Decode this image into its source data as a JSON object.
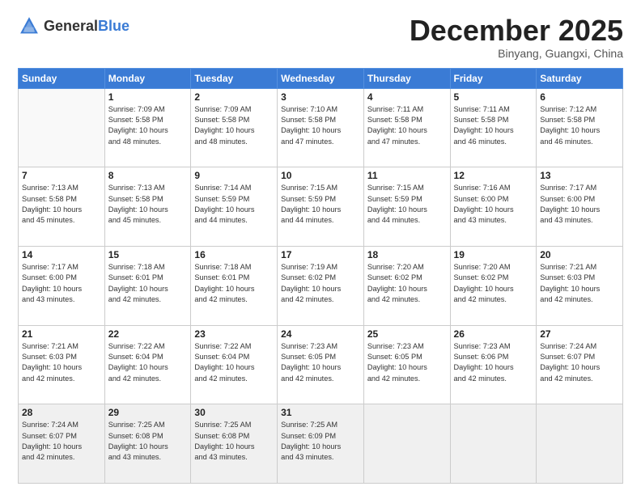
{
  "header": {
    "logo_general": "General",
    "logo_blue": "Blue",
    "month": "December 2025",
    "location": "Binyang, Guangxi, China"
  },
  "weekdays": [
    "Sunday",
    "Monday",
    "Tuesday",
    "Wednesday",
    "Thursday",
    "Friday",
    "Saturday"
  ],
  "weeks": [
    [
      {
        "day": "",
        "info": ""
      },
      {
        "day": "1",
        "info": "Sunrise: 7:09 AM\nSunset: 5:58 PM\nDaylight: 10 hours\nand 48 minutes."
      },
      {
        "day": "2",
        "info": "Sunrise: 7:09 AM\nSunset: 5:58 PM\nDaylight: 10 hours\nand 48 minutes."
      },
      {
        "day": "3",
        "info": "Sunrise: 7:10 AM\nSunset: 5:58 PM\nDaylight: 10 hours\nand 47 minutes."
      },
      {
        "day": "4",
        "info": "Sunrise: 7:11 AM\nSunset: 5:58 PM\nDaylight: 10 hours\nand 47 minutes."
      },
      {
        "day": "5",
        "info": "Sunrise: 7:11 AM\nSunset: 5:58 PM\nDaylight: 10 hours\nand 46 minutes."
      },
      {
        "day": "6",
        "info": "Sunrise: 7:12 AM\nSunset: 5:58 PM\nDaylight: 10 hours\nand 46 minutes."
      }
    ],
    [
      {
        "day": "7",
        "info": "Sunrise: 7:13 AM\nSunset: 5:58 PM\nDaylight: 10 hours\nand 45 minutes."
      },
      {
        "day": "8",
        "info": "Sunrise: 7:13 AM\nSunset: 5:58 PM\nDaylight: 10 hours\nand 45 minutes."
      },
      {
        "day": "9",
        "info": "Sunrise: 7:14 AM\nSunset: 5:59 PM\nDaylight: 10 hours\nand 44 minutes."
      },
      {
        "day": "10",
        "info": "Sunrise: 7:15 AM\nSunset: 5:59 PM\nDaylight: 10 hours\nand 44 minutes."
      },
      {
        "day": "11",
        "info": "Sunrise: 7:15 AM\nSunset: 5:59 PM\nDaylight: 10 hours\nand 44 minutes."
      },
      {
        "day": "12",
        "info": "Sunrise: 7:16 AM\nSunset: 6:00 PM\nDaylight: 10 hours\nand 43 minutes."
      },
      {
        "day": "13",
        "info": "Sunrise: 7:17 AM\nSunset: 6:00 PM\nDaylight: 10 hours\nand 43 minutes."
      }
    ],
    [
      {
        "day": "14",
        "info": "Sunrise: 7:17 AM\nSunset: 6:00 PM\nDaylight: 10 hours\nand 43 minutes."
      },
      {
        "day": "15",
        "info": "Sunrise: 7:18 AM\nSunset: 6:01 PM\nDaylight: 10 hours\nand 42 minutes."
      },
      {
        "day": "16",
        "info": "Sunrise: 7:18 AM\nSunset: 6:01 PM\nDaylight: 10 hours\nand 42 minutes."
      },
      {
        "day": "17",
        "info": "Sunrise: 7:19 AM\nSunset: 6:02 PM\nDaylight: 10 hours\nand 42 minutes."
      },
      {
        "day": "18",
        "info": "Sunrise: 7:20 AM\nSunset: 6:02 PM\nDaylight: 10 hours\nand 42 minutes."
      },
      {
        "day": "19",
        "info": "Sunrise: 7:20 AM\nSunset: 6:02 PM\nDaylight: 10 hours\nand 42 minutes."
      },
      {
        "day": "20",
        "info": "Sunrise: 7:21 AM\nSunset: 6:03 PM\nDaylight: 10 hours\nand 42 minutes."
      }
    ],
    [
      {
        "day": "21",
        "info": "Sunrise: 7:21 AM\nSunset: 6:03 PM\nDaylight: 10 hours\nand 42 minutes."
      },
      {
        "day": "22",
        "info": "Sunrise: 7:22 AM\nSunset: 6:04 PM\nDaylight: 10 hours\nand 42 minutes."
      },
      {
        "day": "23",
        "info": "Sunrise: 7:22 AM\nSunset: 6:04 PM\nDaylight: 10 hours\nand 42 minutes."
      },
      {
        "day": "24",
        "info": "Sunrise: 7:23 AM\nSunset: 6:05 PM\nDaylight: 10 hours\nand 42 minutes."
      },
      {
        "day": "25",
        "info": "Sunrise: 7:23 AM\nSunset: 6:05 PM\nDaylight: 10 hours\nand 42 minutes."
      },
      {
        "day": "26",
        "info": "Sunrise: 7:23 AM\nSunset: 6:06 PM\nDaylight: 10 hours\nand 42 minutes."
      },
      {
        "day": "27",
        "info": "Sunrise: 7:24 AM\nSunset: 6:07 PM\nDaylight: 10 hours\nand 42 minutes."
      }
    ],
    [
      {
        "day": "28",
        "info": "Sunrise: 7:24 AM\nSunset: 6:07 PM\nDaylight: 10 hours\nand 42 minutes."
      },
      {
        "day": "29",
        "info": "Sunrise: 7:25 AM\nSunset: 6:08 PM\nDaylight: 10 hours\nand 43 minutes."
      },
      {
        "day": "30",
        "info": "Sunrise: 7:25 AM\nSunset: 6:08 PM\nDaylight: 10 hours\nand 43 minutes."
      },
      {
        "day": "31",
        "info": "Sunrise: 7:25 AM\nSunset: 6:09 PM\nDaylight: 10 hours\nand 43 minutes."
      },
      {
        "day": "",
        "info": ""
      },
      {
        "day": "",
        "info": ""
      },
      {
        "day": "",
        "info": ""
      }
    ]
  ]
}
